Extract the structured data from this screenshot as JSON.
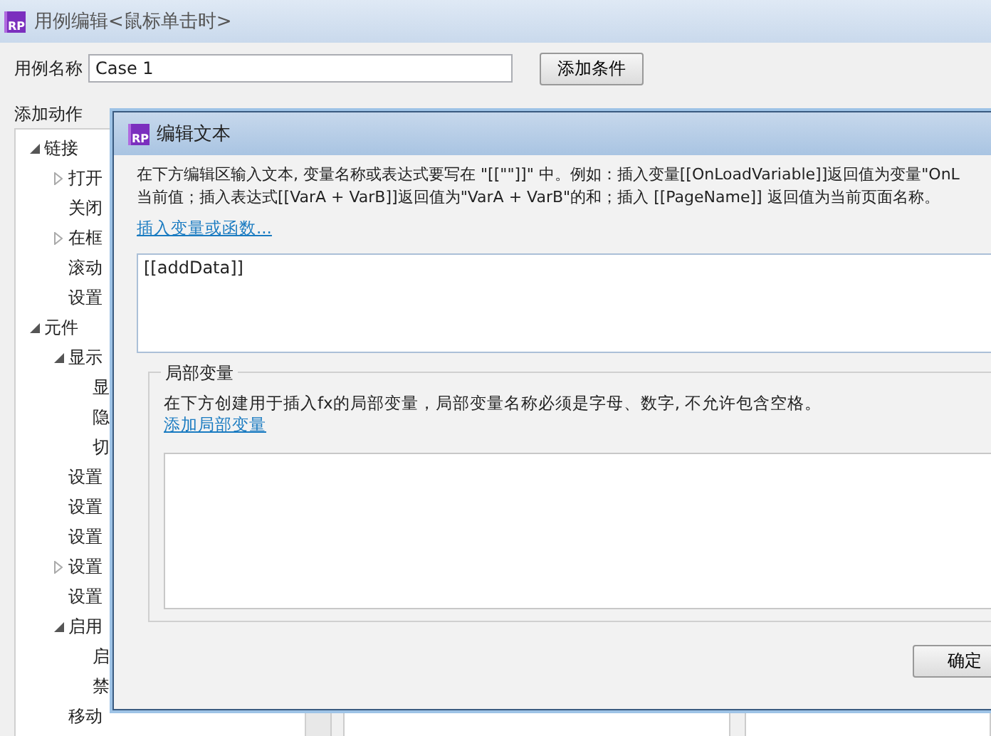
{
  "window": {
    "icon_text": "RP",
    "title": "用例编辑<鼠标单击时>"
  },
  "case_name": {
    "label": "用例名称",
    "value": "Case 1"
  },
  "add_condition_button": "添加条件",
  "actions_panel": {
    "title": "添加动作",
    "tree": [
      {
        "label": "链接",
        "expanded": true,
        "children": [
          {
            "label": "打开",
            "expanded": false
          },
          {
            "label": "关闭"
          },
          {
            "label": "在框",
            "expanded": false
          },
          {
            "label": "滚动"
          },
          {
            "label": "设置"
          }
        ]
      },
      {
        "label": "元件",
        "expanded": true,
        "children": [
          {
            "label": "显示",
            "expanded": true,
            "children": [
              {
                "label": "显"
              },
              {
                "label": "隐"
              },
              {
                "label": "切"
              }
            ]
          },
          {
            "label": "设置"
          },
          {
            "label": "设置"
          },
          {
            "label": "设置"
          },
          {
            "label": "设置",
            "expanded": false
          },
          {
            "label": "设置"
          },
          {
            "label": "启用",
            "expanded": true,
            "children": [
              {
                "label": "启"
              },
              {
                "label": "禁"
              }
            ]
          },
          {
            "label": "移动"
          }
        ]
      }
    ]
  },
  "dialog": {
    "icon_text": "RP",
    "title": "编辑文本",
    "description_lines": [
      "在下方编辑区输入文本, 变量名称或表达式要写在 \"[[\"\"]]\" 中。例如：插入变量[[OnLoadVariable]]返回值为变量\"OnL",
      "当前值；插入表达式[[VarA + VarB]]返回值为\"VarA + VarB\"的和；插入 [[PageName]] 返回值为当前页面名称。"
    ],
    "insert_link": "插入变量或函数...",
    "text_value": "[[addData]]",
    "local_variables": {
      "legend": "局部变量",
      "description": "在下方创建用于插入fx的局部变量，局部变量名称必须是字母、数字, 不允许包含空格。",
      "add_link": "添加局部变量"
    },
    "ok_button": "确定"
  }
}
